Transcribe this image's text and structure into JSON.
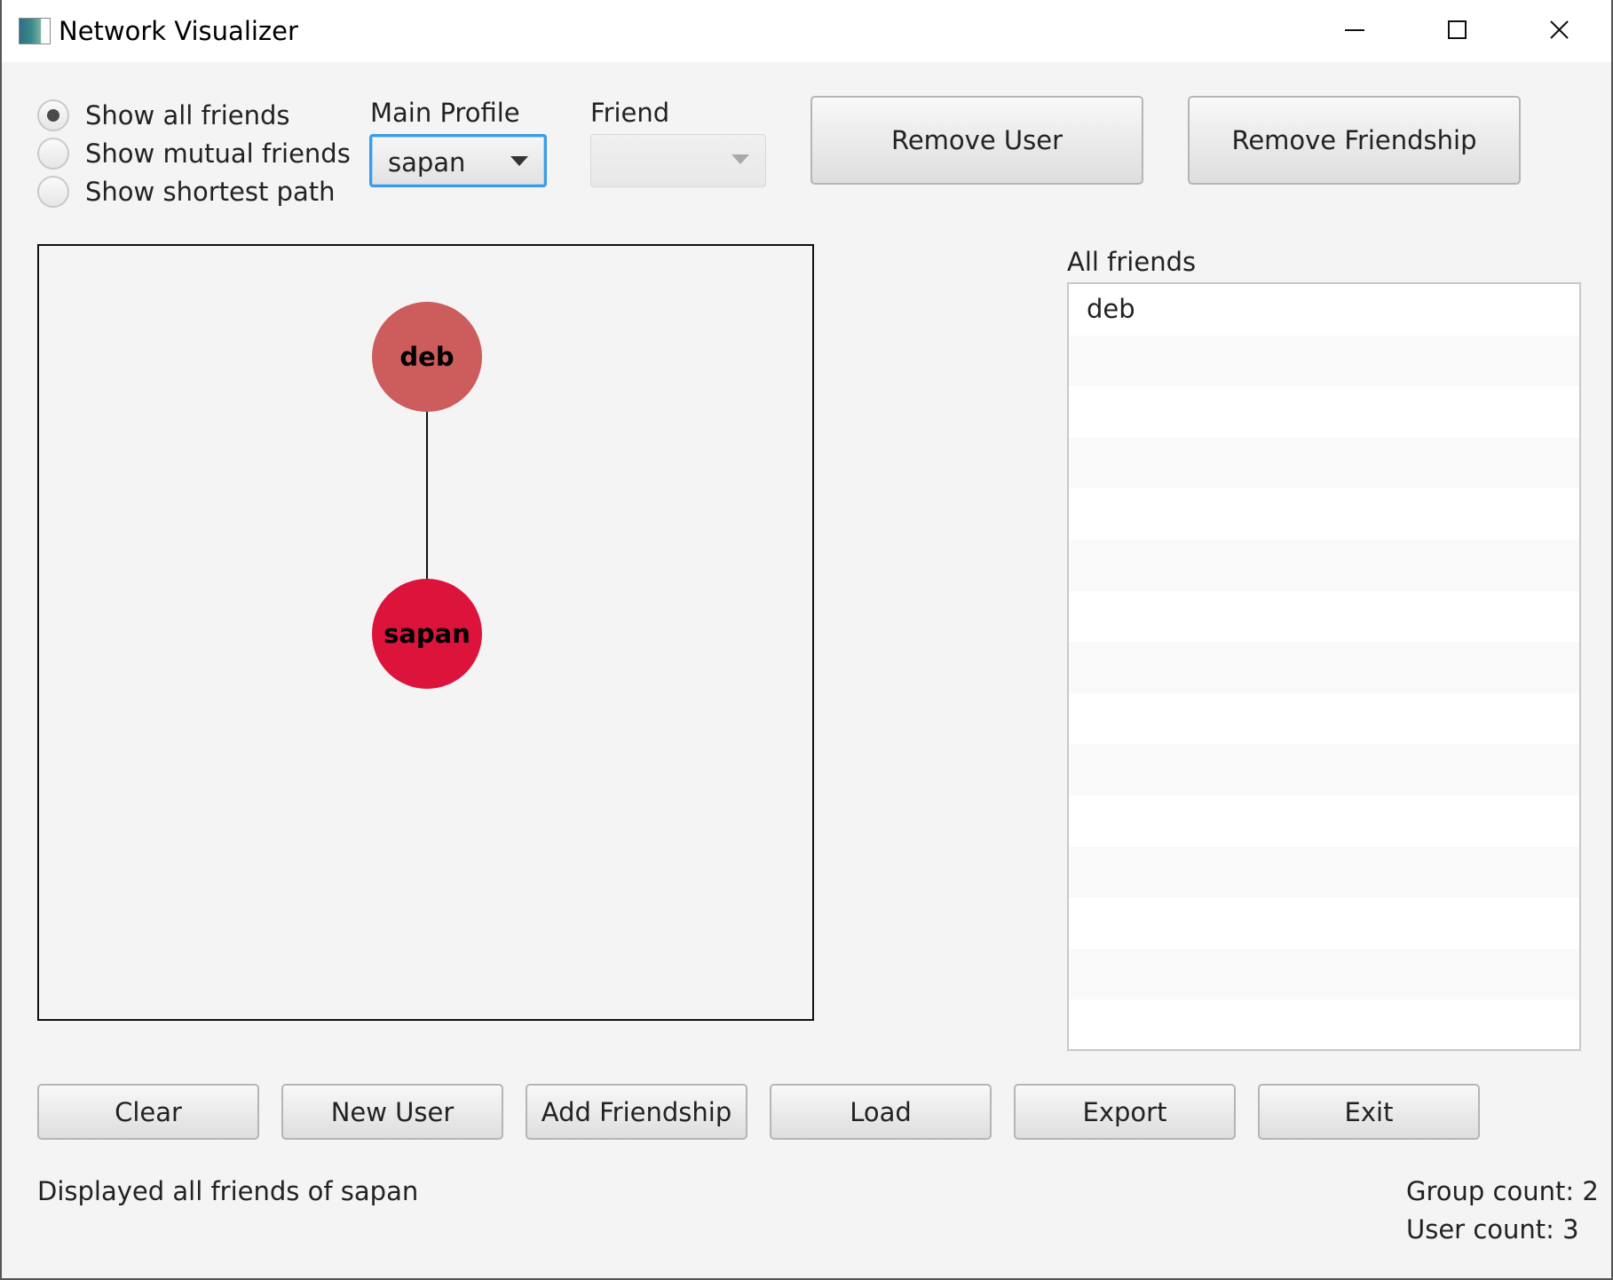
{
  "window": {
    "title": "Network Visualizer",
    "icon": "app-window-icon",
    "controls": {
      "minimize_icon": "minimize-icon",
      "maximize_icon": "maximize-icon",
      "close_icon": "close-icon"
    }
  },
  "view_mode": {
    "options": [
      {
        "label": "Show all friends",
        "checked": true
      },
      {
        "label": "Show mutual friends",
        "checked": false
      },
      {
        "label": "Show shortest path",
        "checked": false
      }
    ]
  },
  "main_profile": {
    "label": "Main Profile",
    "value": "sapan"
  },
  "friend_select": {
    "label": "Friend",
    "value": "",
    "disabled": true
  },
  "top_buttons": {
    "remove_user": "Remove User",
    "remove_friendship": "Remove Friendship"
  },
  "graph": {
    "nodes": [
      {
        "label": "deb",
        "color": "#cd5c5c"
      },
      {
        "label": "sapan",
        "color": "#dc143c"
      }
    ],
    "edges": [
      [
        "deb",
        "sapan"
      ]
    ]
  },
  "friends_list": {
    "label": "All friends",
    "items": [
      "deb"
    ]
  },
  "bottom_buttons": {
    "clear": "Clear",
    "new_user": "New User",
    "add_friendship": "Add Friendship",
    "load": "Load",
    "export": "Export",
    "exit": "Exit"
  },
  "status": {
    "message": "Displayed all friends of sapan",
    "group_count": "Group count: 2",
    "user_count": "User count: 3"
  },
  "colors": {
    "focus_border": "#3a9be8",
    "node_deb": "#cd5c5c",
    "node_sapan": "#dc143c"
  }
}
